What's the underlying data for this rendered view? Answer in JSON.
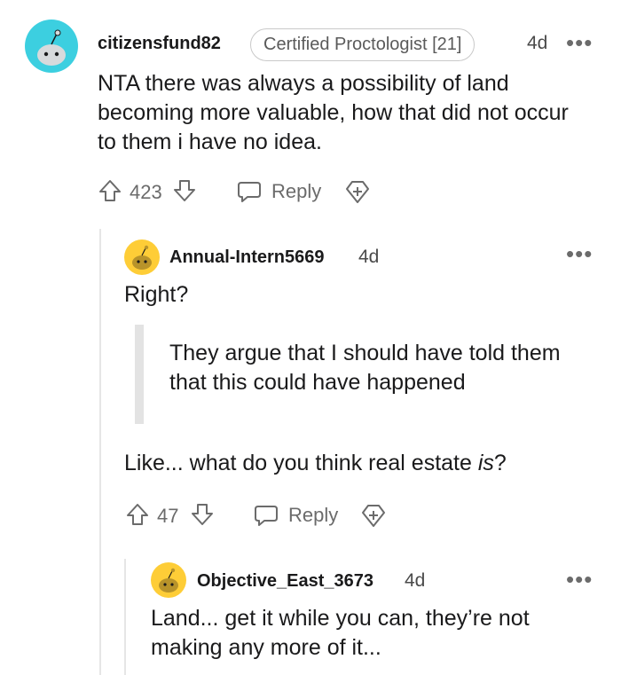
{
  "colors": {
    "teal_avatar": "#3ccfe0",
    "gold_avatar": "#fecd37",
    "muted": "#6b6b6b"
  },
  "comments": [
    {
      "username": "citizensfund82",
      "flair": "Certified Proctologist [21]",
      "time": "4d",
      "more": "•••",
      "body": "NTA there was always a possibility of land becoming more valuable, how that did not occur to them i have no idea.",
      "votes": "423",
      "reply": "Reply"
    },
    {
      "username": "Annual-Intern5669",
      "time": "4d",
      "more": "•••",
      "line1": "Right?",
      "quote": "They argue that I should have told them that this could have happened",
      "line2_before": "Like... what do you think real estate ",
      "line2_em": "is",
      "line2_after": "?",
      "votes": "47",
      "reply": "Reply"
    },
    {
      "username": "Objective_East_3673",
      "time": "4d",
      "more": "•••",
      "body": "Land... get it while you can, they’re not making any more of it..."
    }
  ]
}
